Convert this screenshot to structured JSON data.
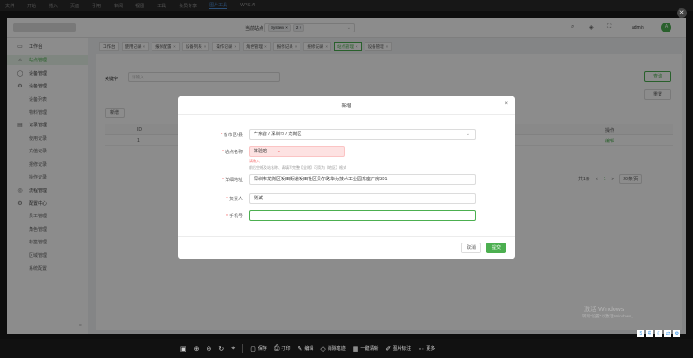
{
  "viewer_topbar": {
    "items": [
      "文件",
      "开始",
      "插入",
      "页面",
      "引用",
      "审阅",
      "视图",
      "工具",
      "会员专享",
      "图片工具",
      "WPS AI"
    ],
    "active_index": 9
  },
  "header": {
    "site_label": "当前站点",
    "site_chips": [
      "System ×",
      "2 ×"
    ],
    "user_name": "admin",
    "avatar_text": "A",
    "accent": "#4caf50"
  },
  "sidebar": {
    "items": [
      {
        "label": "工作台",
        "icon": "monitor-icon",
        "glyph": "▭",
        "sub": false
      },
      {
        "label": "站点管理",
        "icon": "home-icon",
        "glyph": "⌂",
        "sub": false,
        "active": true
      },
      {
        "label": "设备管理",
        "icon": "user-icon",
        "glyph": "◯",
        "sub": false
      },
      {
        "label": "设备管理",
        "icon": "settings-icon",
        "glyph": "⚙",
        "sub": false
      },
      {
        "label": "设备列表",
        "sub": true
      },
      {
        "label": "物料管理",
        "sub": true
      },
      {
        "label": "记录管理",
        "icon": "document-icon",
        "glyph": "▤",
        "sub": false
      },
      {
        "label": "使用记录",
        "sub": true
      },
      {
        "label": "充值记录",
        "sub": true
      },
      {
        "label": "报修记录",
        "sub": true
      },
      {
        "label": "操作记录",
        "sub": true
      },
      {
        "label": "流程管理",
        "icon": "globe-icon",
        "glyph": "◎",
        "sub": false
      },
      {
        "label": "配置中心",
        "icon": "gear-icon",
        "glyph": "⚙",
        "sub": false
      },
      {
        "label": "员工管理",
        "sub": true
      },
      {
        "label": "角色管理",
        "sub": true
      },
      {
        "label": "标签管理",
        "sub": true
      },
      {
        "label": "区域管理",
        "sub": true
      },
      {
        "label": "系统配置",
        "sub": true
      }
    ]
  },
  "tabs": [
    {
      "label": "工作台",
      "closable": false
    },
    {
      "label": "使用记录",
      "closable": true
    },
    {
      "label": "报修配置",
      "closable": true
    },
    {
      "label": "设备列表",
      "closable": true
    },
    {
      "label": "操作记录",
      "closable": true
    },
    {
      "label": "角色管理",
      "closable": true
    },
    {
      "label": "报修记录",
      "closable": true
    },
    {
      "label": "报修记录",
      "closable": true
    },
    {
      "label": "站点管理",
      "closable": true,
      "active": true
    },
    {
      "label": "设备管理",
      "closable": true
    }
  ],
  "main": {
    "search_label": "关键字",
    "search_placeholder": "请输入",
    "search_button": "查询",
    "reset_button": "重置",
    "add_button": "新增",
    "columns": [
      "ID",
      "操作"
    ],
    "rows": [
      {
        "id": "1",
        "action": "编辑"
      }
    ],
    "pagination": {
      "total": "共1条",
      "prev": "<",
      "page": "1",
      "next": ">",
      "page_size": "20条/页"
    }
  },
  "dialog": {
    "title": "新增",
    "fields": [
      {
        "label": "省市区/县",
        "required": true,
        "value": "广东省 / 深圳市 / 龙岗区",
        "type": "cascader"
      },
      {
        "label": "站点名称",
        "required": true,
        "value": "体验馆",
        "type": "error",
        "error": "请输入",
        "hint": "前后空格及站名称、请填写完整【全称】可简为【地区】格式"
      },
      {
        "label": "详细地址",
        "required": true,
        "value": "深圳市龙岗区坂田街道坂田社区贝尔路华为技术工业园东座厂房301",
        "type": "text"
      },
      {
        "label": "负责人",
        "required": true,
        "value": "测试",
        "type": "text"
      },
      {
        "label": "手机号",
        "required": true,
        "value": "",
        "type": "focus"
      }
    ],
    "cancel_button": "取消",
    "submit_button": "提交"
  },
  "watermark": {
    "line1": "激活 Windows",
    "line2": "转到\"设置\"以激活 Windows。"
  },
  "toolbar": {
    "items": [
      {
        "label": "",
        "icon": "fit-icon",
        "glyph": "▣"
      },
      {
        "label": "",
        "icon": "zoom-in-icon",
        "glyph": "⊕"
      },
      {
        "label": "",
        "icon": "zoom-out-icon",
        "glyph": "⊖"
      },
      {
        "label": "",
        "icon": "rotate-icon",
        "glyph": "↻"
      },
      {
        "label": "",
        "icon": "location-icon",
        "glyph": "⌖"
      },
      {
        "label": "保存",
        "icon": "save-icon",
        "glyph": "▢"
      },
      {
        "label": "打印",
        "icon": "print-icon",
        "glyph": "⎙"
      },
      {
        "label": "编辑",
        "icon": "edit-icon",
        "glyph": "✎"
      },
      {
        "label": "消除笔迹",
        "icon": "erase-icon",
        "glyph": "◇"
      },
      {
        "label": "一键清晰",
        "icon": "sharpen-icon",
        "glyph": "▦"
      },
      {
        "label": "图片标注",
        "icon": "annotate-icon",
        "glyph": "✐"
      },
      {
        "label": "更多",
        "icon": "more-icon",
        "glyph": "⋯"
      }
    ]
  }
}
